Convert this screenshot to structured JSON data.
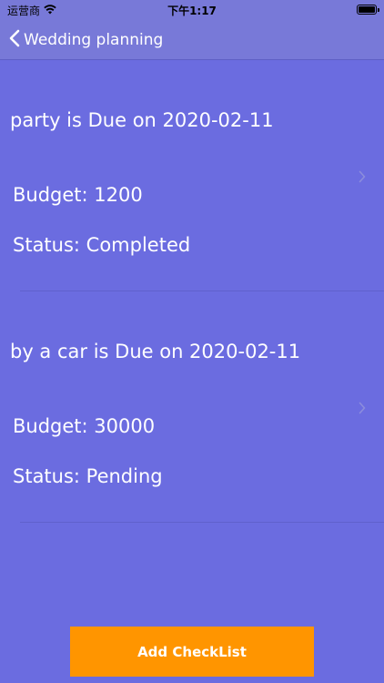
{
  "status_bar": {
    "carrier": "运营商",
    "time": "下午1:17"
  },
  "nav": {
    "back_label": "Wedding planning"
  },
  "checklist": [
    {
      "title": "party is Due on 2020-02-11",
      "budget": "Budget: 1200",
      "status": "Status: Completed"
    },
    {
      "title": "by a car is Due on 2020-02-11",
      "budget": "Budget: 30000",
      "status": "Status: Pending"
    }
  ],
  "actions": {
    "add_label": "Add CheckList"
  },
  "colors": {
    "background": "#6b6ce0",
    "accent": "#ff9500",
    "text": "#ffffff"
  }
}
